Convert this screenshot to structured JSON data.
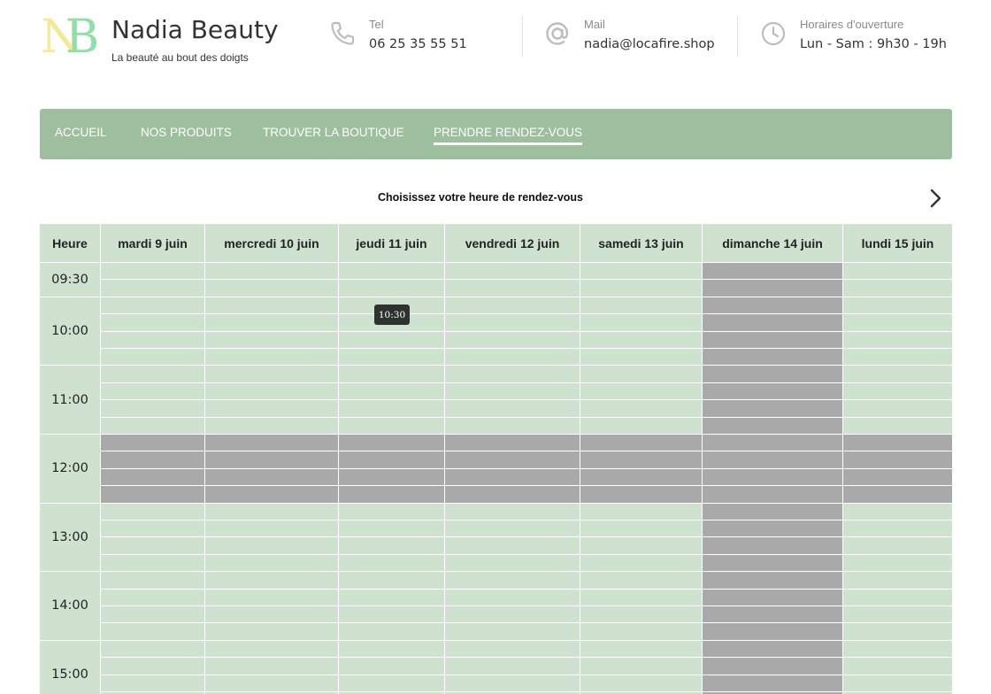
{
  "brand": {
    "monogram_n": "N",
    "monogram_b": "B",
    "name": "Nadia Beauty",
    "tagline": "La beauté au bout des doigts"
  },
  "contacts": {
    "phone": {
      "label": "Tel",
      "value": "06 25 35 55 51",
      "icon": "phone-icon"
    },
    "mail": {
      "label": "Mail",
      "value": "nadia@locafire.shop",
      "icon": "at-icon"
    },
    "hours": {
      "label": "Horaires d'ouverture",
      "value": "Lun - Sam : 9h30 - 19h",
      "icon": "clock-icon"
    }
  },
  "nav": {
    "items": [
      {
        "label": "ACCUEIL"
      },
      {
        "label": "NOS PRODUITS"
      },
      {
        "label": "TROUVER LA BOUTIQUE"
      },
      {
        "label": "PRENDRE RENDEZ-VOUS",
        "active": true
      }
    ]
  },
  "calendar": {
    "title": "Choisissez votre heure de rendez-vous",
    "next_icon": "chevron-right-icon",
    "hour_header": "Heure",
    "days": [
      {
        "label": "mardi 9 juin",
        "closed": false
      },
      {
        "label": "mercredi 10 juin",
        "closed": false
      },
      {
        "label": "jeudi 11 juin",
        "closed": false
      },
      {
        "label": "vendredi 12 juin",
        "closed": false
      },
      {
        "label": "samedi 13 juin",
        "closed": false
      },
      {
        "label": "dimanche 14 juin",
        "closed": true
      },
      {
        "label": "lundi 15 juin",
        "closed": false
      }
    ],
    "hours": [
      "09:30",
      "10:00",
      "11:00",
      "12:00",
      "13:00",
      "14:00",
      "15:00"
    ],
    "unavailable_range": {
      "from": "12:00",
      "to": "13:00"
    },
    "hover_tooltip": "10:30"
  },
  "colors": {
    "nav_bg": "#9dbf9e",
    "slot_available": "#cfe2cf",
    "slot_unavailable": "#a9a9a9",
    "tooltip_bg": "#2f3330"
  }
}
